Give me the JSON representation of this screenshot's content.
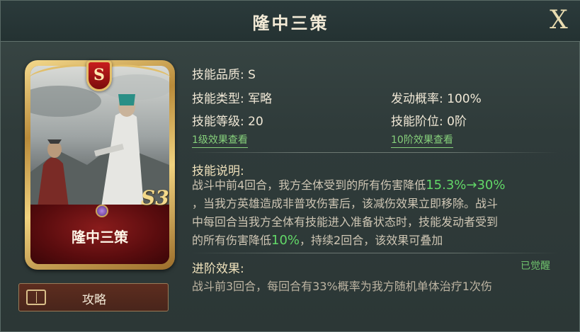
{
  "header": {
    "title": "隆中三策",
    "close_label": "X"
  },
  "card": {
    "grade_badge": "S",
    "name": "隆中三策",
    "level_mark": "S3"
  },
  "guide_button": {
    "label": "攻略"
  },
  "skill": {
    "quality": "技能品质: S",
    "type": "技能类型: 军略",
    "trigger_rate": "发动概率: 100%",
    "level": "技能等级: 20",
    "stage": "技能阶位: 0阶",
    "link_level1": "1级效果查看",
    "link_stage10": "10阶效果查看"
  },
  "description": {
    "title": "技能说明:",
    "line1_a": "战斗中前4回合，我方全体受到的所有伤害降低",
    "line1_hl": "15.3%→30%",
    "line2": "，当我方英雄造成非普攻伤害后，该减伤效果立即移除。战斗",
    "line3": "中每回合当我方全体有技能进入准备状态时，技能发动者受到",
    "line4_a": "的所有伤害降低",
    "line4_hl": "10%",
    "line4_b": "，持续2回合，该效果可叠加"
  },
  "advanced": {
    "title": "进阶效果:",
    "status": "已觉醒",
    "text": "战斗前3回合，每回合有33%概率为我方随机单体治疗1次伤"
  },
  "colors": {
    "highlight_green": "#62d868",
    "link_green": "#86d07b",
    "card_gold": "#e1bf6c",
    "card_red": "#8a1c1c"
  },
  "icons": {
    "close": "close-x-icon",
    "guide": "book-icon",
    "gem": "purple-gem-icon"
  }
}
